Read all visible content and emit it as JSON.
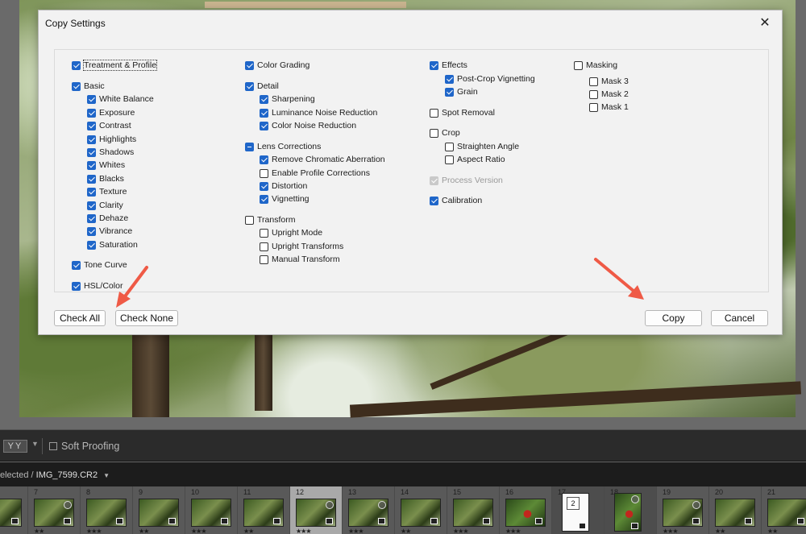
{
  "dialog": {
    "title": "Copy Settings",
    "close_glyph": "✕",
    "check_all_label": "Check All",
    "check_none_label": "Check None",
    "copy_label": "Copy",
    "cancel_label": "Cancel"
  },
  "options": {
    "col1": {
      "treatment": "Treatment & Profile",
      "basic": "Basic",
      "white_balance": "White Balance",
      "exposure": "Exposure",
      "contrast": "Contrast",
      "highlights": "Highlights",
      "shadows": "Shadows",
      "whites": "Whites",
      "blacks": "Blacks",
      "texture": "Texture",
      "clarity": "Clarity",
      "dehaze": "Dehaze",
      "vibrance": "Vibrance",
      "saturation": "Saturation",
      "tone_curve": "Tone Curve",
      "hsl_color": "HSL/Color"
    },
    "col2": {
      "color_grading": "Color Grading",
      "detail": "Detail",
      "sharpening": "Sharpening",
      "luminance_nr": "Luminance Noise Reduction",
      "color_nr": "Color Noise Reduction",
      "lens_corrections": "Lens Corrections",
      "remove_ca": "Remove Chromatic Aberration",
      "enable_profile": "Enable Profile Corrections",
      "distortion": "Distortion",
      "vignetting": "Vignetting",
      "transform": "Transform",
      "upright_mode": "Upright Mode",
      "upright_transforms": "Upright Transforms",
      "manual_transform": "Manual Transform"
    },
    "col3": {
      "effects": "Effects",
      "post_crop": "Post-Crop Vignetting",
      "grain": "Grain",
      "spot_removal": "Spot Removal",
      "crop": "Crop",
      "straighten": "Straighten Angle",
      "aspect": "Aspect Ratio",
      "process_version": "Process Version",
      "calibration": "Calibration"
    },
    "col4": {
      "masking": "Masking",
      "mask3": "Mask 3",
      "mask2": "Mask 2",
      "mask1": "Mask 1"
    }
  },
  "toolbar": {
    "view_toggle": "YY",
    "soft_proofing": "Soft Proofing"
  },
  "filmstrip": {
    "status_prefix": "elected /",
    "filename": "IMG_7599.CR2",
    "dropdown_glyph": "▼",
    "stack_count": "2",
    "cells": [
      {
        "num": "",
        "stars": "★★"
      },
      {
        "num": "7",
        "stars": "★★"
      },
      {
        "num": "8",
        "stars": "★★★"
      },
      {
        "num": "9",
        "stars": "★★"
      },
      {
        "num": "10",
        "stars": "★★★"
      },
      {
        "num": "11",
        "stars": "★★"
      },
      {
        "num": "12",
        "stars": "★★★"
      },
      {
        "num": "13",
        "stars": "★★★"
      },
      {
        "num": "14",
        "stars": "★★"
      },
      {
        "num": "15",
        "stars": "★★★"
      },
      {
        "num": "16",
        "stars": "★★★"
      },
      {
        "num": "17",
        "stars": ""
      },
      {
        "num": "18",
        "stars": ""
      },
      {
        "num": "19",
        "stars": "★★★"
      },
      {
        "num": "20",
        "stars": "★★"
      },
      {
        "num": "21",
        "stars": "★★"
      }
    ]
  },
  "colors": {
    "checkbox_accent": "#1f66c9",
    "arrow": "#ef5a46"
  }
}
